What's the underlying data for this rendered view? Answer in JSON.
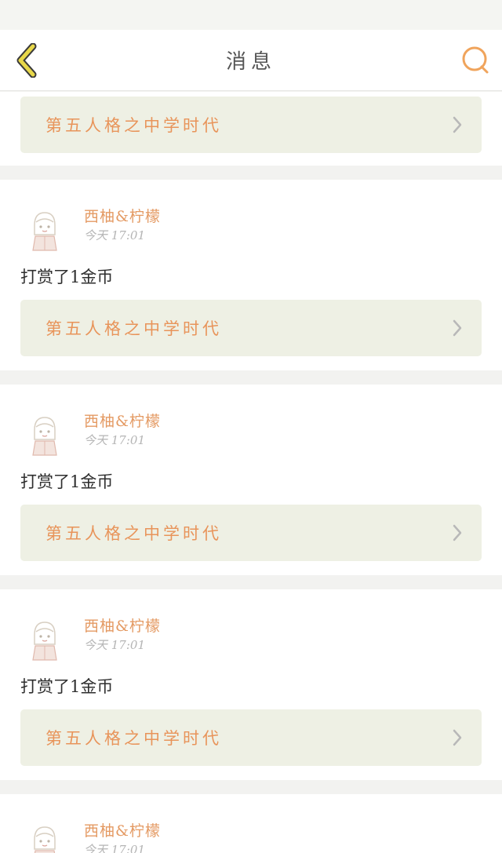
{
  "header": {
    "title": "消息",
    "back_icon": "chevron-left-icon",
    "search_icon": "search-icon",
    "accent_color": "#f0a45c",
    "back_color": "#e8d84a"
  },
  "feed": {
    "first_card": {
      "link_text": "第五人格之中学时代"
    },
    "items": [
      {
        "author": "西柚&柠檬",
        "time": "今天 17:01",
        "message": "打赏了1金币",
        "link_text": "第五人格之中学时代"
      },
      {
        "author": "西柚&柠檬",
        "time": "今天 17:01",
        "message": "打赏了1金币",
        "link_text": "第五人格之中学时代"
      },
      {
        "author": "西柚&柠檬",
        "time": "今天 17:01",
        "message": "打赏了1金币",
        "link_text": "第五人格之中学时代"
      }
    ],
    "last_card": {
      "author": "西柚&柠檬",
      "time": "今天 17:01"
    }
  }
}
